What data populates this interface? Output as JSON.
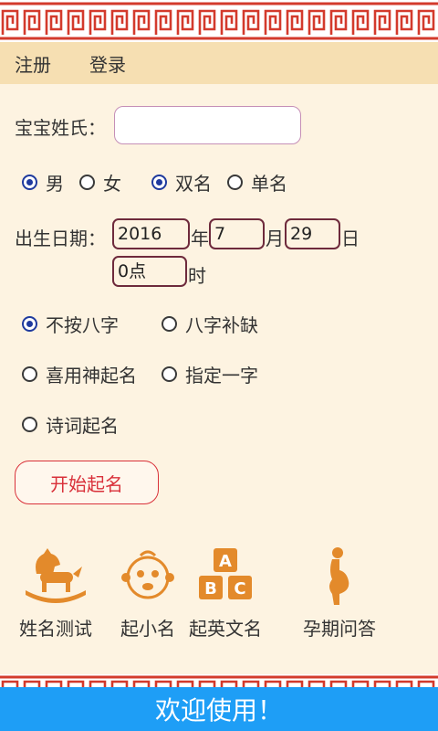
{
  "menu": {
    "register": "注册",
    "login": "登录"
  },
  "form": {
    "surname_label": "宝宝姓氏：",
    "surname_value": "",
    "gender": {
      "male": "男",
      "female": "女"
    },
    "name_length": {
      "double": "双名",
      "single": "单名"
    },
    "birth_label": "出生日期：",
    "year_value": "2016",
    "year_unit": "年",
    "month_value": "7",
    "month_unit": "月",
    "day_value": "29",
    "day_unit": "日",
    "hour_value": "0点",
    "hour_unit": "时",
    "options": {
      "no_bazi": "不按八字",
      "bazi_fix": "八字补缺",
      "xiyong": "喜用神起名",
      "fixed_char": "指定一字",
      "poetry": "诗词起名"
    },
    "start_button": "开始起名"
  },
  "tools": {
    "name_test": "姓名测试",
    "nickname": "起小名",
    "english_name": "起英文名",
    "pregnancy_qa": "孕期问答"
  },
  "footer": {
    "welcome": "欢迎使用！"
  },
  "colors": {
    "accent_red": "#d9313a",
    "radio_blue": "#1f3a9e",
    "footer_blue": "#1e9ef6",
    "icon_orange": "#e38a2b"
  }
}
